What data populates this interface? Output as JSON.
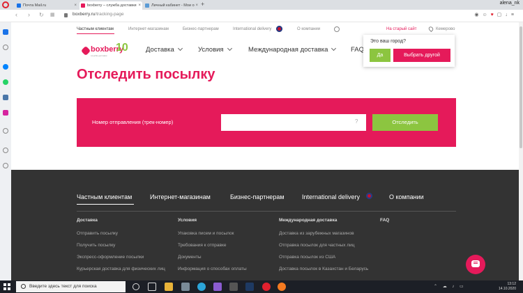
{
  "browser": {
    "tabs": [
      {
        "title": "Почта Mail.ru",
        "fav_color": "#1a73e8"
      },
      {
        "title": "boxberry – служба доставки",
        "fav_color": "#e51a5a"
      },
      {
        "title": "Личный кабинет - Мои о",
        "fav_color": "#5b9bd5"
      }
    ],
    "new_tab": "+",
    "user_name": "alena_nk",
    "url_domain": "boxberry.ru",
    "url_path": "/tracking-page",
    "toolbar_icons": [
      "camera-icon",
      "smile-icon",
      "heart-icon",
      "bookmark-icon",
      "download-icon",
      "menu-icon"
    ]
  },
  "site": {
    "top_nav": [
      {
        "label": "Частным клиентам",
        "active": true
      },
      {
        "label": "Интернет-магазинам",
        "active": false
      },
      {
        "label": "Бизнес-партнерам",
        "active": false
      },
      {
        "label": "International delivery",
        "active": false
      },
      {
        "label": "О компании",
        "active": false
      }
    ],
    "old_site_link": "На старый сайт",
    "city": "Кемерово",
    "logo_text": "boxberry",
    "logo_sub": "служба доставки",
    "logo_anniversary": "10",
    "main_nav": [
      {
        "label": "Доставка"
      },
      {
        "label": "Условия"
      },
      {
        "label": "Международная доставка"
      },
      {
        "label": "FAQ"
      }
    ],
    "city_popup": {
      "question": "Это ваш город?",
      "yes": "Да",
      "other": "Выбрать другой"
    },
    "page_title": "Отследить посылку",
    "tracking": {
      "label": "Номер отправления (трек-номер)",
      "input_value": "",
      "help": "?",
      "button": "Отследить"
    },
    "colors": {
      "brand_pink": "#e51a5a",
      "brand_green": "#8cc540",
      "footer_bg": "#333333"
    }
  },
  "footer": {
    "tabs": [
      {
        "label": "Частным клиентам"
      },
      {
        "label": "Интернет-магазинам"
      },
      {
        "label": "Бизнес-партнерам"
      },
      {
        "label": "International delivery"
      },
      {
        "label": "О компании"
      }
    ],
    "columns": [
      {
        "head": "Доставка",
        "links": [
          "Отправить посылку",
          "Получить посылку",
          "Экспресс-оформление посылки",
          "Курьерская доставка для физических лиц"
        ]
      },
      {
        "head": "Условия",
        "links": [
          "Упаковка писем и посылок",
          "Требования к отправке",
          "Документы",
          "Информация о способах оплаты"
        ]
      },
      {
        "head": "Международная доставка",
        "links": [
          "Доставка из зарубежных магазинов",
          "Отправка посылок для частных лиц",
          "Отправка посылок из США",
          "Доставка посылок в Казахстан и Беларусь"
        ]
      },
      {
        "head": "FAQ",
        "links": []
      }
    ]
  },
  "taskbar": {
    "search_placeholder": "Введите здесь текст для поиска",
    "time": "13:12",
    "date": "14.10.2020"
  }
}
